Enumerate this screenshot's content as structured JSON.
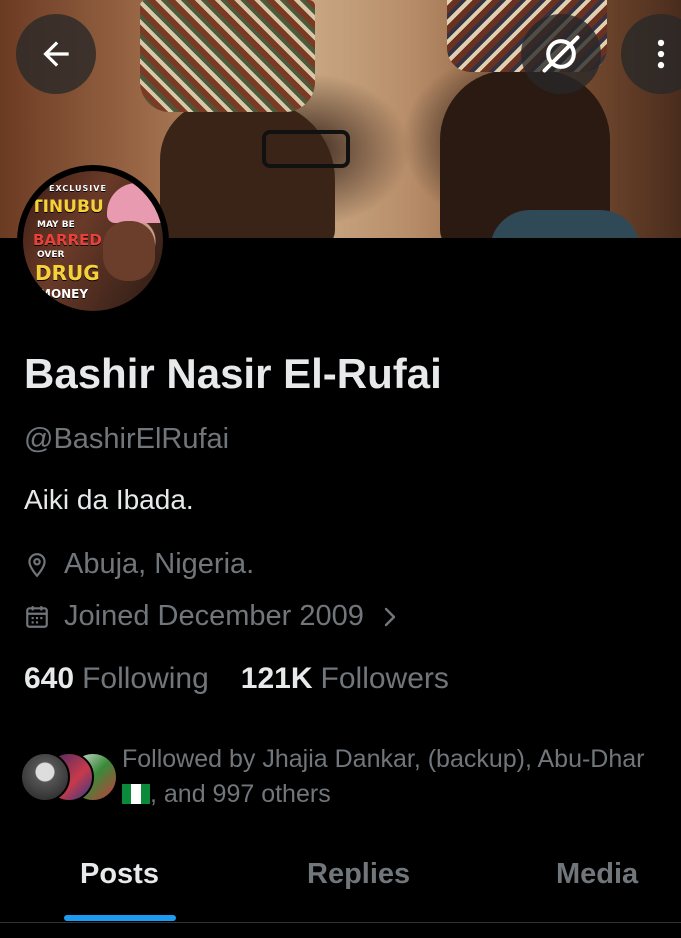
{
  "profile": {
    "name": "Bashir Nasir El-Rufai",
    "handle": "@BashirElRufai",
    "bio": "Aiki da Ibada.",
    "location": "Abuja, Nigeria.",
    "joined": "Joined December 2009",
    "following_count": "640",
    "following_label": "Following",
    "followers_count": "121K",
    "followers_label": "Followers"
  },
  "avatar_image": {
    "lines": [
      "EXCLUSIVE",
      "TINUBU",
      "MAY BE",
      "BARRED",
      "OVER",
      "DRUG",
      "MONEY"
    ]
  },
  "followed_by": {
    "text": "Followed by Jhajia Dankar, (backup), Abu-Dhar",
    "text_end": ", and 997 others"
  },
  "tabs": [
    {
      "label": "Posts",
      "active": true
    },
    {
      "label": "Replies",
      "active": false
    },
    {
      "label": "Media",
      "active": false
    }
  ],
  "icons": {
    "back": "arrow-left-icon",
    "grok": "grok-icon",
    "more": "more-vertical-icon",
    "location": "location-pin-icon",
    "calendar": "calendar-icon",
    "chevron": "chevron-right-icon"
  },
  "colors": {
    "background": "#000000",
    "primary_text": "#e7e9ea",
    "secondary_text": "#71767b",
    "accent": "#1d9bf0"
  }
}
